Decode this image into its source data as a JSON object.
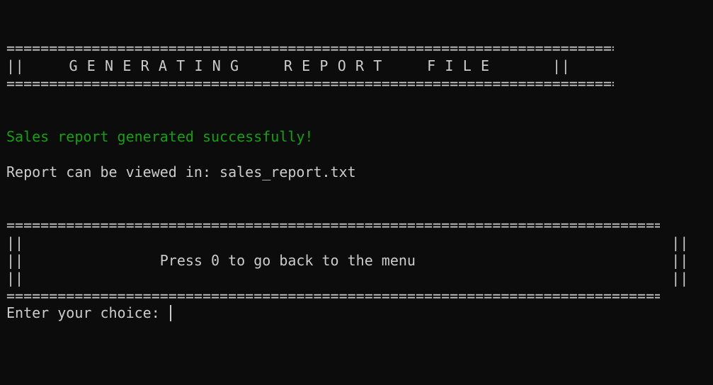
{
  "header": {
    "top_rule": "===========================================================================",
    "title_line": "||     G E N E R A T I N G     R E P O R T     F I L E       ||",
    "bottom_rule": "==========================================================================="
  },
  "messages": {
    "success": "Sales report generated successfully!",
    "report_location": "Report can be viewed in: sales_report.txt"
  },
  "menu_box": {
    "top_rule": "=================================================================================",
    "blank_line_1": "||                                                                            ||",
    "prompt_line": "||                Press 0 to go back to the menu                              ||",
    "blank_line_2": "||                                                                            ||",
    "bottom_rule": "================================================================================="
  },
  "input": {
    "prompt": "Enter your choice: ",
    "value": ""
  },
  "colors": {
    "background": "#0c0c0c",
    "text": "#cccccc",
    "success": "#13a10e"
  }
}
